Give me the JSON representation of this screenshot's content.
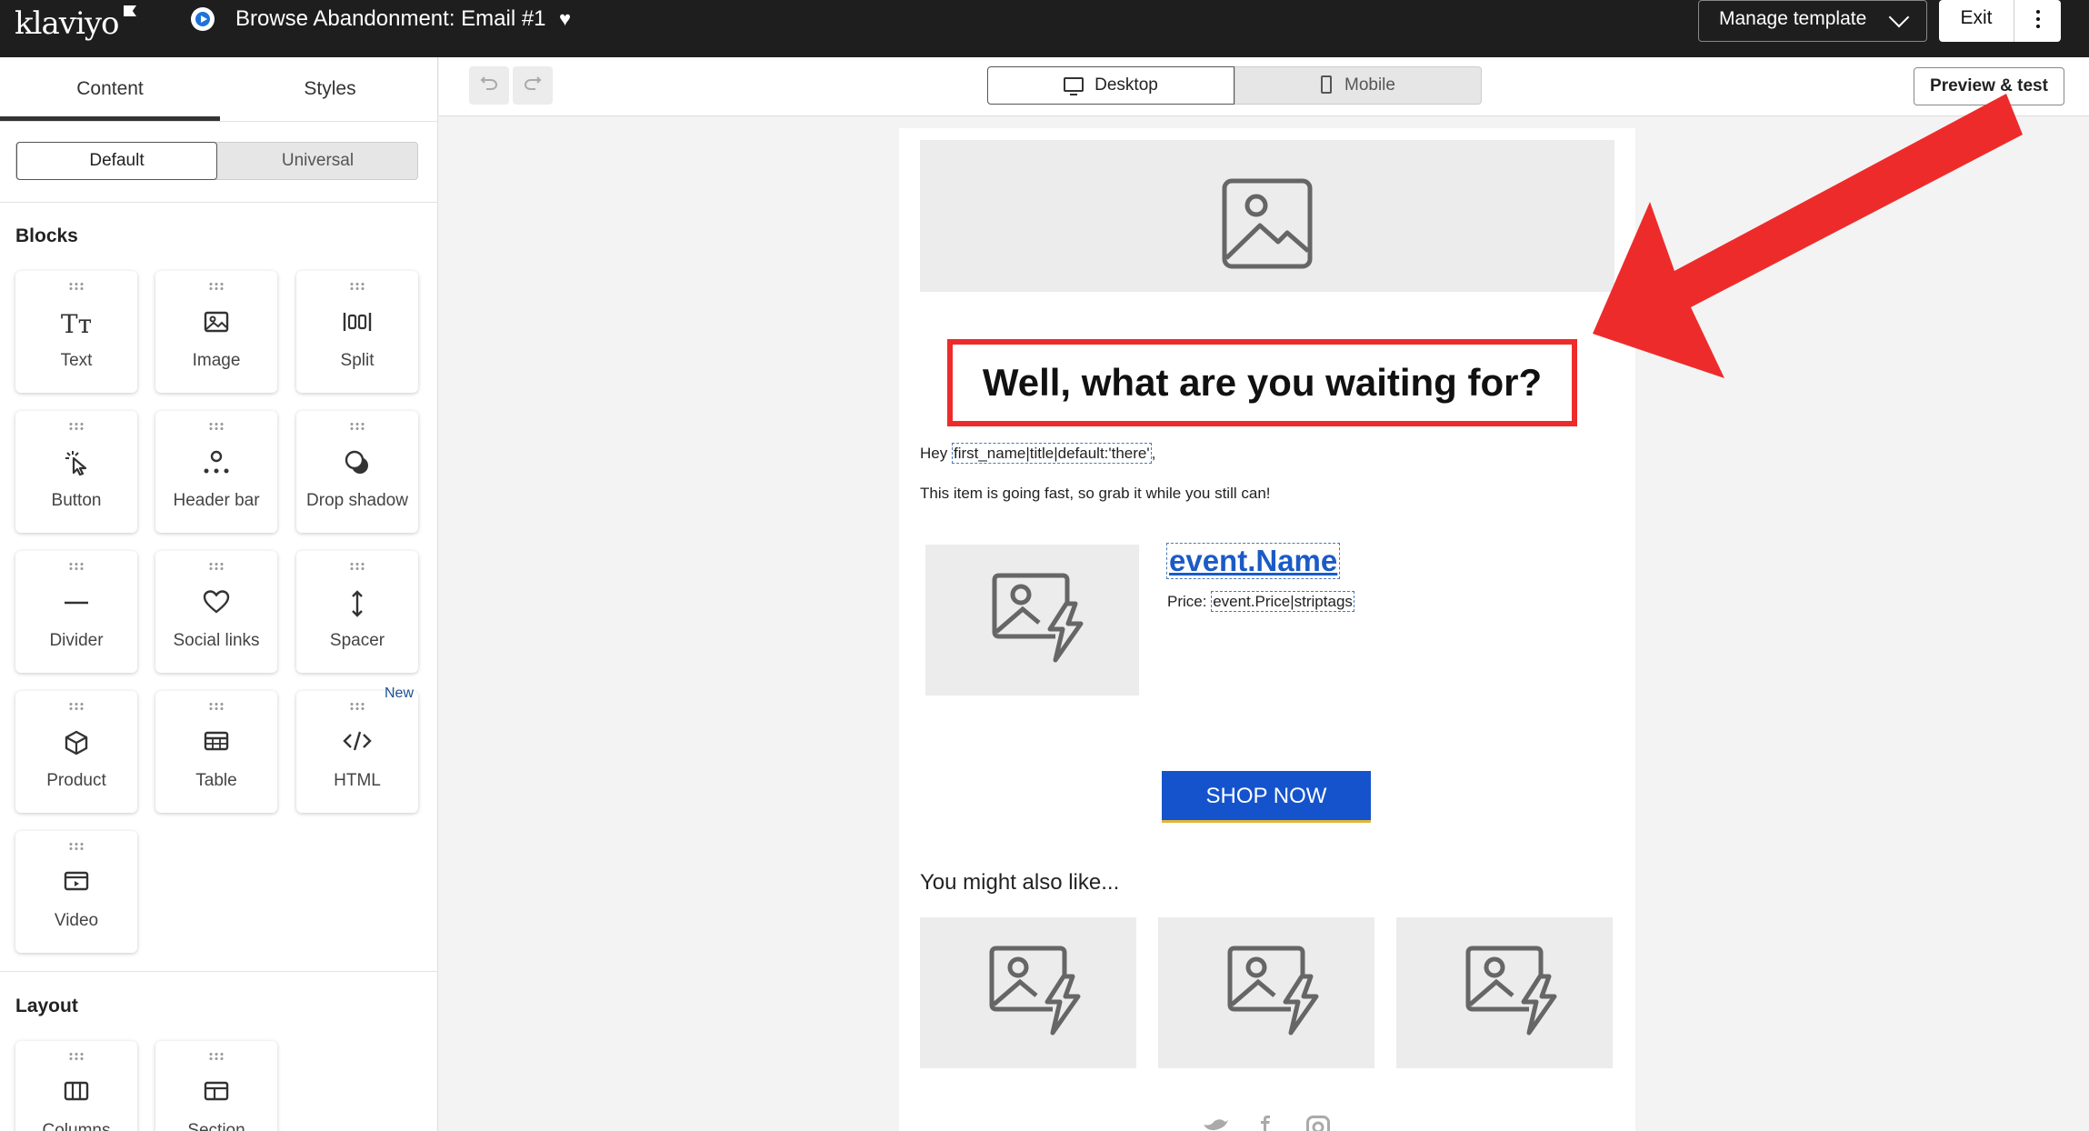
{
  "app": {
    "logo": "klaviyo",
    "template_title": "Browse Abandonment: Email #1"
  },
  "topbar": {
    "manage_label": "Manage template",
    "exit_label": "Exit"
  },
  "sidebar": {
    "tabs": [
      "Content",
      "Styles"
    ],
    "segments": [
      "Default",
      "Universal"
    ],
    "blocks_heading": "Blocks",
    "blocks": [
      {
        "label": "Text",
        "icon": "text-icon"
      },
      {
        "label": "Image",
        "icon": "image-icon"
      },
      {
        "label": "Split",
        "icon": "split-icon"
      },
      {
        "label": "Button",
        "icon": "cursor-click-icon"
      },
      {
        "label": "Header bar",
        "icon": "header-bar-icon"
      },
      {
        "label": "Drop shadow",
        "icon": "drop-shadow-icon"
      },
      {
        "label": "Divider",
        "icon": "divider-icon"
      },
      {
        "label": "Social links",
        "icon": "heart-icon"
      },
      {
        "label": "Spacer",
        "icon": "spacer-icon"
      },
      {
        "label": "Product",
        "icon": "cube-icon"
      },
      {
        "label": "Table",
        "icon": "table-icon"
      },
      {
        "label": "HTML",
        "icon": "code-icon"
      },
      {
        "label": "Video",
        "icon": "video-icon"
      }
    ],
    "new_badge": "New",
    "layout_heading": "Layout",
    "layout_blocks": [
      {
        "label": "Columns",
        "icon": "columns-icon"
      },
      {
        "label": "Section",
        "icon": "section-icon"
      }
    ]
  },
  "canvas_toolbar": {
    "desktop_label": "Desktop",
    "mobile_label": "Mobile",
    "preview_label": "Preview & test"
  },
  "email": {
    "headline": "Well, what are you waiting for?",
    "greeting_prefix": "Hey ",
    "greeting_tag": "first_name|title|default:'there'",
    "greeting_suffix": ",",
    "body_line": "This item is going fast, so grab it while you still can!",
    "event_name": "event.Name",
    "price_prefix": "Price: ",
    "price_tag": "event.Price|striptags",
    "shop_button": "SHOP NOW",
    "also_like": "You might also like..."
  },
  "colors": {
    "topbar": "#1e1e1e",
    "accent_blue": "#1453cc",
    "highlight_red": "#ee2b2b",
    "placeholder": "#ececec"
  }
}
